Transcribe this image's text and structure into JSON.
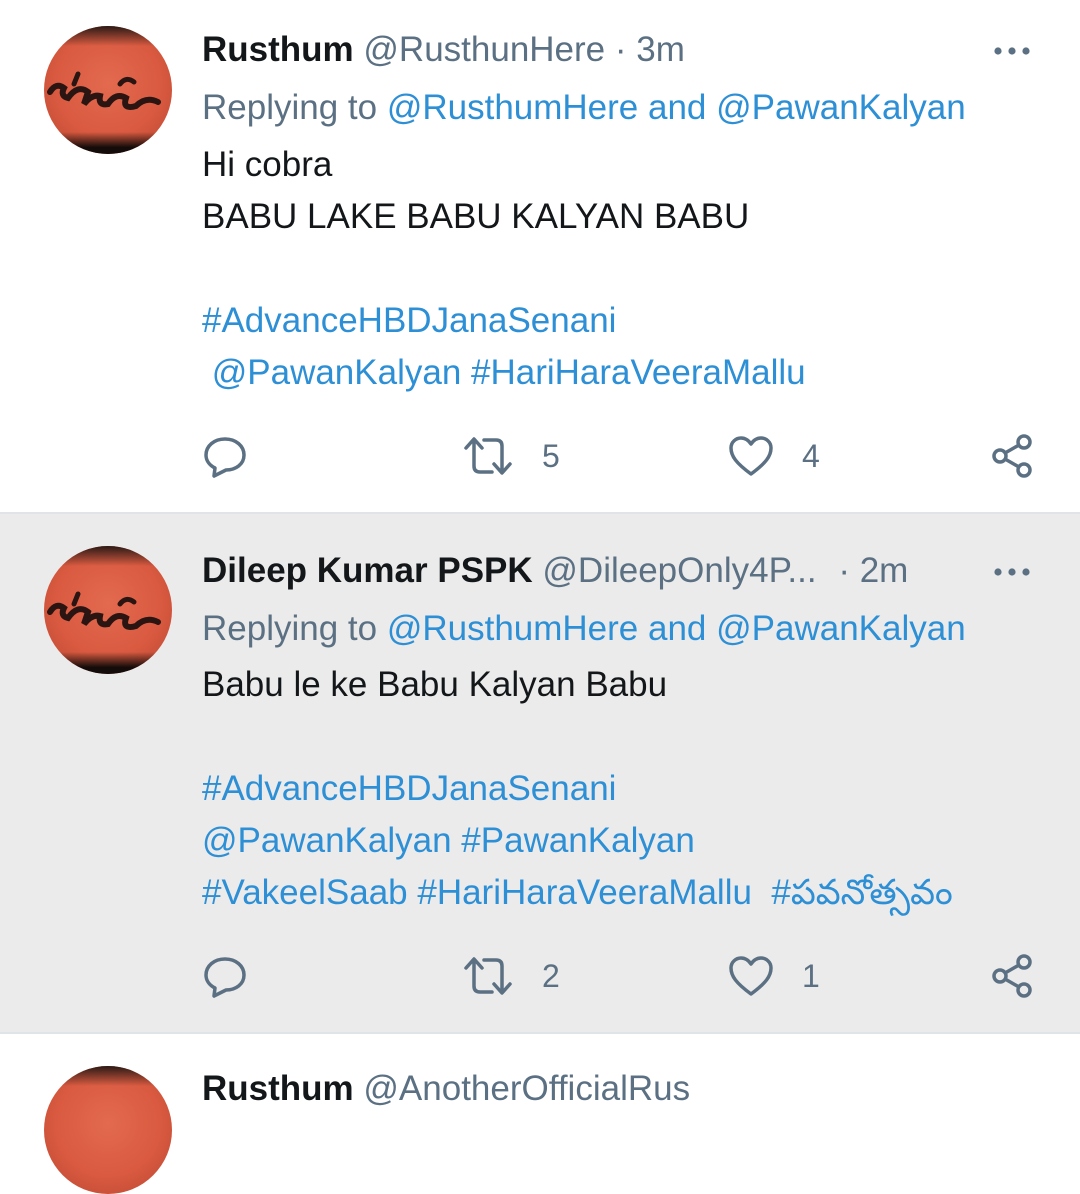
{
  "tweets": [
    {
      "name": "Rusthum",
      "handle": "@RusthunHere",
      "separator": "·",
      "time": "3m",
      "replying_prefix": "Replying to ",
      "replying_user1": "@RusthumHere",
      "replying_and": " and ",
      "replying_user2": "@PawanKalyan",
      "lines": [
        "Hi cobra",
        "BABU LAKE BABU KALYAN BABU"
      ],
      "hashtag_lines": [
        "#AdvanceHBDJanaSenani",
        " @PawanKalyan #HariHaraVeeraMallu"
      ],
      "retweets": "5",
      "likes": "4"
    },
    {
      "name": "Dileep Kumar PSPK",
      "handle": "@DileepOnly4P...",
      "separator": "·",
      "time": "2m",
      "replying_prefix": "Replying to ",
      "replying_user1": "@RusthumHere",
      "replying_and": " and ",
      "replying_user2": "@PawanKalyan",
      "lines": [
        "Babu le ke Babu Kalyan Babu"
      ],
      "hashtag_lines": [
        "#AdvanceHBDJanaSenani",
        "@PawanKalyan #PawanKalyan",
        "#VakeelSaab #HariHaraVeeraMallu  #పవనోత్సవం"
      ],
      "retweets": "2",
      "likes": "1"
    },
    {
      "name": "Rusthum",
      "handle": "@AnotherOfficialRus"
    }
  ],
  "icons": {
    "reply": "reply-icon",
    "retweet": "retweet-icon",
    "like": "heart-icon",
    "share": "share-icon",
    "more": "more-options-icon"
  },
  "colors": {
    "link": "#2d8fd5",
    "muted": "#5b7083",
    "text": "#14171a",
    "highlight_bg": "#ebebeb"
  }
}
